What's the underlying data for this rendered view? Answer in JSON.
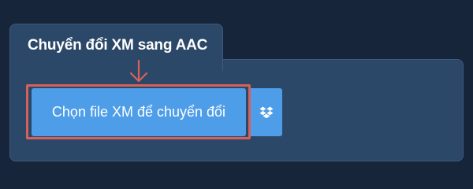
{
  "panel": {
    "title": "Chuyển đổi XM sang AAC"
  },
  "upload": {
    "choose_file_label": "Chọn file XM để chuyển đổi",
    "dropbox_icon": "dropbox-icon"
  },
  "colors": {
    "background": "#16253a",
    "panel": "#2c4868",
    "button": "#4d9de8",
    "highlight": "#d9605a"
  }
}
